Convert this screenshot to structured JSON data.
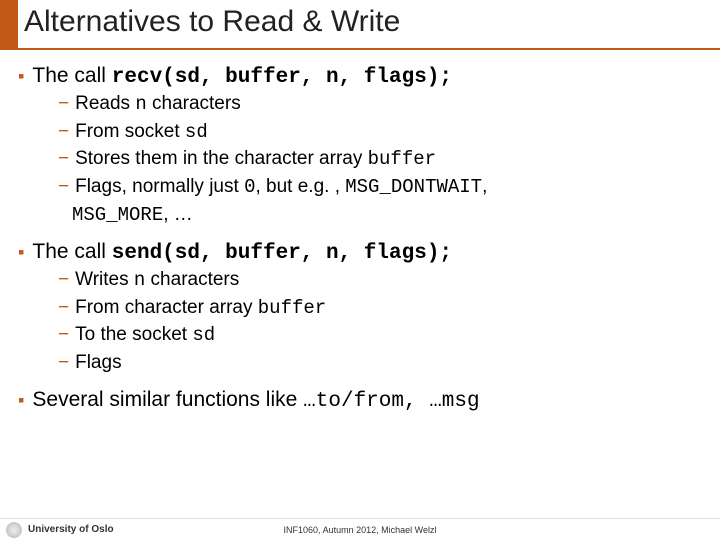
{
  "title": "Alternatives to Read & Write",
  "items": [
    {
      "lead": "The call ",
      "code": "recv(sd, buffer, n, flags);",
      "subs": [
        {
          "pre": "Reads ",
          "code": "n",
          "post": " characters"
        },
        {
          "pre": "From socket ",
          "code": "sd",
          "post": ""
        },
        {
          "pre": "Stores them in the character array ",
          "code": "buffer",
          "post": ""
        },
        {
          "pre": "Flags, normally just ",
          "code": "0",
          "post": ", but e.g. , ",
          "code2": "MSG_DONTWAIT",
          "post2": ","
        }
      ],
      "cont_code": "MSG_MORE",
      "cont_post": ", …"
    },
    {
      "lead": "The call ",
      "code": "send(sd, buffer, n, flags);",
      "subs": [
        {
          "pre": "Writes ",
          "code": "n",
          "post": " characters"
        },
        {
          "pre": "From character array ",
          "code": "buffer",
          "post": ""
        },
        {
          "pre": "To the socket ",
          "code": "sd",
          "post": ""
        },
        {
          "pre": "Flags",
          "code": "",
          "post": ""
        }
      ]
    },
    {
      "lead": " Several similar functions like ",
      "tail1": "…to/from, ",
      "tail2": "…msg"
    }
  ],
  "footer": {
    "uni": "University of Oslo",
    "course": "INF1060, Autumn 2012, Michael Welzl"
  }
}
